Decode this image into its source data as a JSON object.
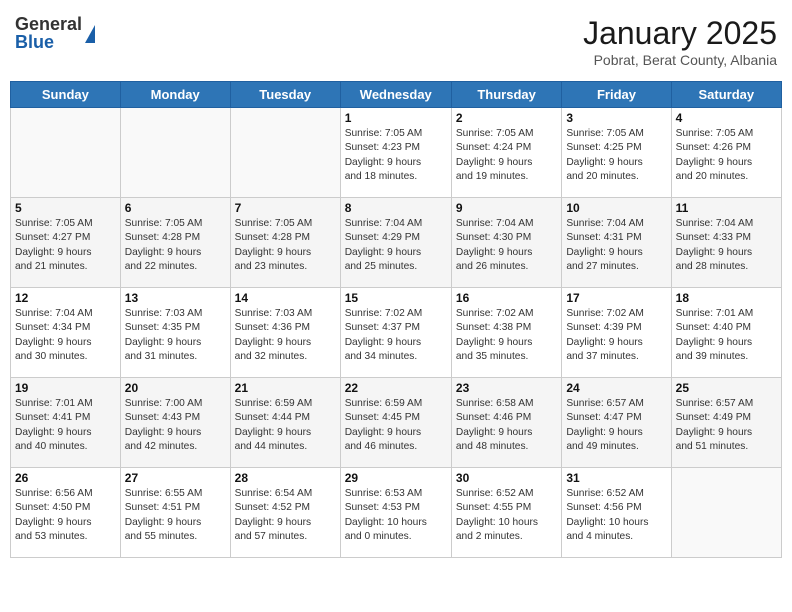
{
  "header": {
    "logo_general": "General",
    "logo_blue": "Blue",
    "month_year": "January 2025",
    "location": "Pobrat, Berat County, Albania"
  },
  "days_of_week": [
    "Sunday",
    "Monday",
    "Tuesday",
    "Wednesday",
    "Thursday",
    "Friday",
    "Saturday"
  ],
  "weeks": [
    [
      {
        "day": "",
        "info": ""
      },
      {
        "day": "",
        "info": ""
      },
      {
        "day": "",
        "info": ""
      },
      {
        "day": "1",
        "info": "Sunrise: 7:05 AM\nSunset: 4:23 PM\nDaylight: 9 hours\nand 18 minutes."
      },
      {
        "day": "2",
        "info": "Sunrise: 7:05 AM\nSunset: 4:24 PM\nDaylight: 9 hours\nand 19 minutes."
      },
      {
        "day": "3",
        "info": "Sunrise: 7:05 AM\nSunset: 4:25 PM\nDaylight: 9 hours\nand 20 minutes."
      },
      {
        "day": "4",
        "info": "Sunrise: 7:05 AM\nSunset: 4:26 PM\nDaylight: 9 hours\nand 20 minutes."
      }
    ],
    [
      {
        "day": "5",
        "info": "Sunrise: 7:05 AM\nSunset: 4:27 PM\nDaylight: 9 hours\nand 21 minutes."
      },
      {
        "day": "6",
        "info": "Sunrise: 7:05 AM\nSunset: 4:28 PM\nDaylight: 9 hours\nand 22 minutes."
      },
      {
        "day": "7",
        "info": "Sunrise: 7:05 AM\nSunset: 4:28 PM\nDaylight: 9 hours\nand 23 minutes."
      },
      {
        "day": "8",
        "info": "Sunrise: 7:04 AM\nSunset: 4:29 PM\nDaylight: 9 hours\nand 25 minutes."
      },
      {
        "day": "9",
        "info": "Sunrise: 7:04 AM\nSunset: 4:30 PM\nDaylight: 9 hours\nand 26 minutes."
      },
      {
        "day": "10",
        "info": "Sunrise: 7:04 AM\nSunset: 4:31 PM\nDaylight: 9 hours\nand 27 minutes."
      },
      {
        "day": "11",
        "info": "Sunrise: 7:04 AM\nSunset: 4:33 PM\nDaylight: 9 hours\nand 28 minutes."
      }
    ],
    [
      {
        "day": "12",
        "info": "Sunrise: 7:04 AM\nSunset: 4:34 PM\nDaylight: 9 hours\nand 30 minutes."
      },
      {
        "day": "13",
        "info": "Sunrise: 7:03 AM\nSunset: 4:35 PM\nDaylight: 9 hours\nand 31 minutes."
      },
      {
        "day": "14",
        "info": "Sunrise: 7:03 AM\nSunset: 4:36 PM\nDaylight: 9 hours\nand 32 minutes."
      },
      {
        "day": "15",
        "info": "Sunrise: 7:02 AM\nSunset: 4:37 PM\nDaylight: 9 hours\nand 34 minutes."
      },
      {
        "day": "16",
        "info": "Sunrise: 7:02 AM\nSunset: 4:38 PM\nDaylight: 9 hours\nand 35 minutes."
      },
      {
        "day": "17",
        "info": "Sunrise: 7:02 AM\nSunset: 4:39 PM\nDaylight: 9 hours\nand 37 minutes."
      },
      {
        "day": "18",
        "info": "Sunrise: 7:01 AM\nSunset: 4:40 PM\nDaylight: 9 hours\nand 39 minutes."
      }
    ],
    [
      {
        "day": "19",
        "info": "Sunrise: 7:01 AM\nSunset: 4:41 PM\nDaylight: 9 hours\nand 40 minutes."
      },
      {
        "day": "20",
        "info": "Sunrise: 7:00 AM\nSunset: 4:43 PM\nDaylight: 9 hours\nand 42 minutes."
      },
      {
        "day": "21",
        "info": "Sunrise: 6:59 AM\nSunset: 4:44 PM\nDaylight: 9 hours\nand 44 minutes."
      },
      {
        "day": "22",
        "info": "Sunrise: 6:59 AM\nSunset: 4:45 PM\nDaylight: 9 hours\nand 46 minutes."
      },
      {
        "day": "23",
        "info": "Sunrise: 6:58 AM\nSunset: 4:46 PM\nDaylight: 9 hours\nand 48 minutes."
      },
      {
        "day": "24",
        "info": "Sunrise: 6:57 AM\nSunset: 4:47 PM\nDaylight: 9 hours\nand 49 minutes."
      },
      {
        "day": "25",
        "info": "Sunrise: 6:57 AM\nSunset: 4:49 PM\nDaylight: 9 hours\nand 51 minutes."
      }
    ],
    [
      {
        "day": "26",
        "info": "Sunrise: 6:56 AM\nSunset: 4:50 PM\nDaylight: 9 hours\nand 53 minutes."
      },
      {
        "day": "27",
        "info": "Sunrise: 6:55 AM\nSunset: 4:51 PM\nDaylight: 9 hours\nand 55 minutes."
      },
      {
        "day": "28",
        "info": "Sunrise: 6:54 AM\nSunset: 4:52 PM\nDaylight: 9 hours\nand 57 minutes."
      },
      {
        "day": "29",
        "info": "Sunrise: 6:53 AM\nSunset: 4:53 PM\nDaylight: 10 hours\nand 0 minutes."
      },
      {
        "day": "30",
        "info": "Sunrise: 6:52 AM\nSunset: 4:55 PM\nDaylight: 10 hours\nand 2 minutes."
      },
      {
        "day": "31",
        "info": "Sunrise: 6:52 AM\nSunset: 4:56 PM\nDaylight: 10 hours\nand 4 minutes."
      },
      {
        "day": "",
        "info": ""
      }
    ]
  ]
}
